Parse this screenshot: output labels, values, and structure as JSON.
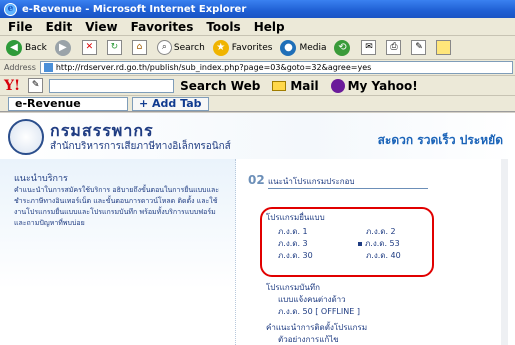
{
  "window": {
    "title": "e-Revenue - Microsoft Internet Explorer"
  },
  "menu": [
    "File",
    "Edit",
    "View",
    "Favorites",
    "Tools",
    "Help"
  ],
  "toolbar": {
    "back": "Back",
    "search": "Search",
    "favorites": "Favorites",
    "media": "Media"
  },
  "address": {
    "label": "Address",
    "url": "http://rdserver.rd.go.th/publish/sub_index.php?page=03&goto=32&agree=yes"
  },
  "yahoo": {
    "logo": "Y!",
    "search_web": "Search Web",
    "mail": "Mail",
    "my_yahoo": "My Yahoo!"
  },
  "tabs": {
    "active": "e-Revenue",
    "add": "+ Add Tab"
  },
  "site": {
    "brand": "กรมสรรพากร",
    "brand_sub": "สำนักบริหารการเสียภาษีทางอิเล็กทรอนิกส์",
    "slogan": "สะดวก  รวดเร็ว  ประหยัด"
  },
  "left": {
    "heading": "แนะนำบริการ",
    "text": "คำแนะนำในการสมัครใช้บริการ อธิบายถึงขั้นตอนในการยื่นแบบและชำระภาษีทางอินเทอร์เน็ต และขั้นตอนการดาวน์โหลด ติดตั้ง และใช้งานโปรแกรมยื่นแบบและโปรแกรมบันทึก พร้อมทั้งบริการแบบฟอร์มและถามปัญหาที่พบบ่อย"
  },
  "right": {
    "num": "02",
    "title": "แนะนำโปรแกรมประกอบ",
    "group1": "โปรแกรมยื่นแบบ",
    "forms": [
      "ภ.ง.ด. 1",
      "ภ.ง.ด. 2",
      "ภ.ง.ด. 3",
      "ภ.ง.ด. 53",
      "ภ.ง.ด. 30",
      "ภ.ง.ด. 40"
    ],
    "group2": "โปรแกรมบันทึก",
    "sub2a": "แบบแจ้งคนต่างด้าว",
    "sub2b": "ภ.ง.ด. 50 [ OFFLINE ]",
    "group3": "คำแนะนำการติดตั้งโปรแกรม",
    "sub3": "ตัวอย่างการแก้ไข"
  }
}
